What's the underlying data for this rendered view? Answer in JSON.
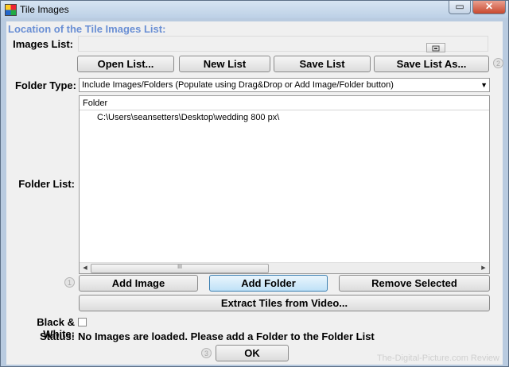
{
  "window": {
    "title": "Tile Images",
    "controls": {
      "minimize": "▭",
      "close": "✕"
    }
  },
  "location": {
    "heading": "Location of the Tile Images List:"
  },
  "images_list": {
    "label": "Images List:",
    "value": "",
    "browse_icon": "folder-browse-icon"
  },
  "list_buttons": {
    "open": "Open List...",
    "new": "New List",
    "save": "Save List",
    "save_as": "Save List As..."
  },
  "step_markers": {
    "one": "1",
    "two": "2",
    "three": "3"
  },
  "folder_type": {
    "label": "Folder Type:",
    "selected": "Include Images/Folders (Populate using Drag&Drop or Add Image/Folder button)"
  },
  "folder_list": {
    "label": "Folder List:",
    "column_header": "Folder",
    "rows": [
      "C:\\Users\\seansetters\\Desktop\\wedding 800 px\\"
    ],
    "scroll_thumb": "III"
  },
  "folder_buttons": {
    "add_image": "Add Image",
    "add_folder": "Add Folder",
    "remove_selected": "Remove Selected",
    "extract_tiles": "Extract Tiles from Video..."
  },
  "black_white": {
    "label": "Black & White:",
    "checked": false
  },
  "status": {
    "label": "Status:",
    "text": "No Images are loaded. Please add a Folder to the Folder List"
  },
  "ok_button": "OK",
  "watermark": "The-Digital-Picture.com Review"
}
